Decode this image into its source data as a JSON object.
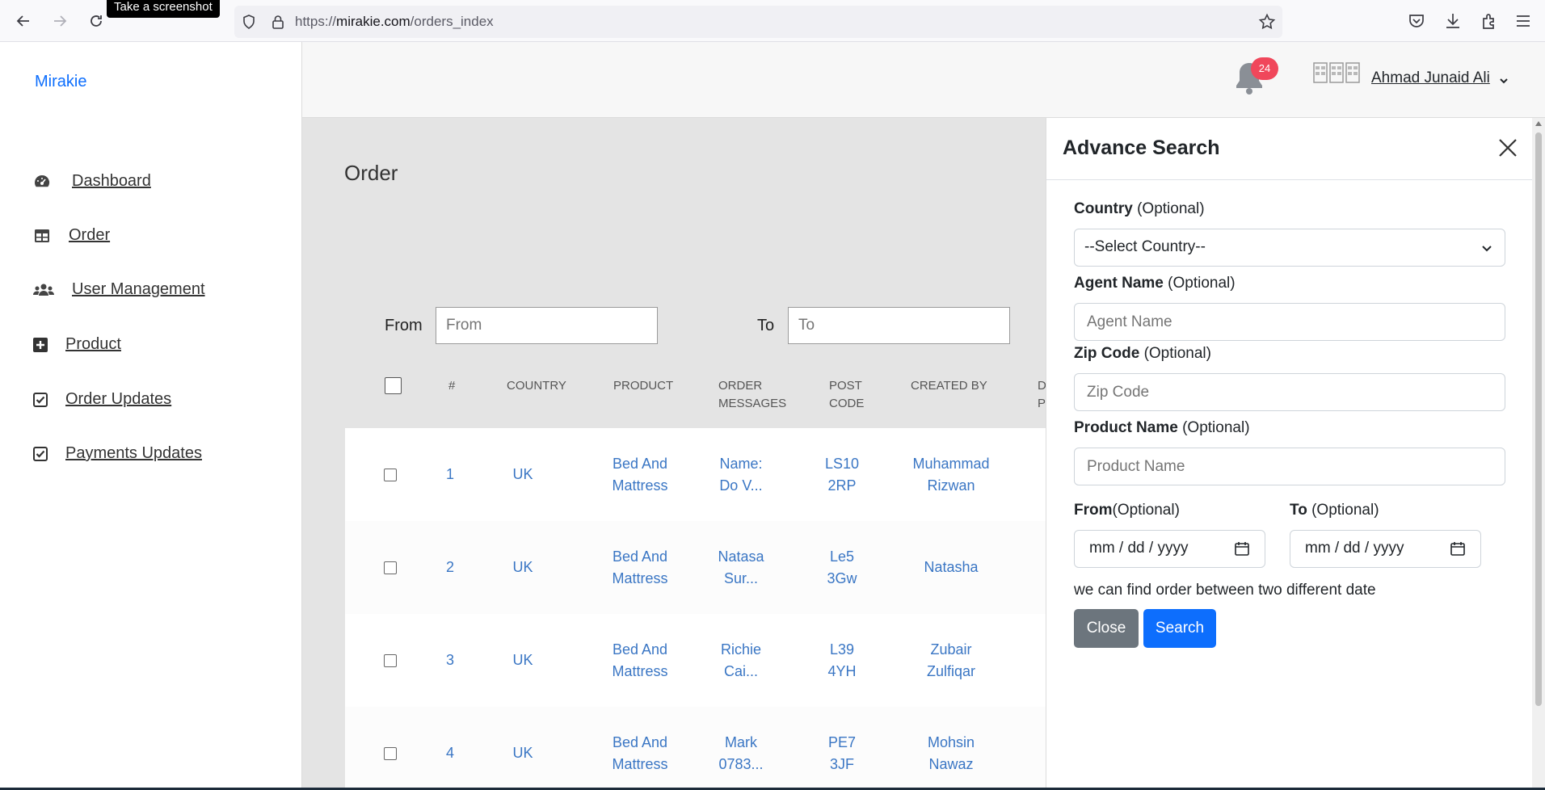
{
  "browser": {
    "tooltip": "Take a screenshot",
    "url_prefix": "https://",
    "url_domain": "mirakie.com",
    "url_path": "/orders_index"
  },
  "header": {
    "brand": "Mirakie",
    "notification_count": "24",
    "user_name": "Ahmad Junaid Ali"
  },
  "sidebar": {
    "items": [
      {
        "label": "Dashboard",
        "icon": "gauge-icon"
      },
      {
        "label": "Order",
        "icon": "table-icon"
      },
      {
        "label": "User Management",
        "icon": "users-icon"
      },
      {
        "label": "Product",
        "icon": "plus-square-icon"
      },
      {
        "label": "Order Updates",
        "icon": "check-square-icon"
      },
      {
        "label": "Payments Updates",
        "icon": "check-square-icon"
      }
    ]
  },
  "main": {
    "title": "Order",
    "filter": {
      "from_label": "From",
      "from_placeholder": "From",
      "to_label": "To",
      "to_placeholder": "To"
    },
    "columns": {
      "num": "#",
      "country": "COUNTRY",
      "product": "PRODUCT",
      "order_messages_1": "ORDER",
      "order_messages_2": "MESSAGES",
      "post_code_1": "POST",
      "post_code_2": "CODE",
      "created_by": "CREATED BY",
      "cut_1": "D",
      "cut_2": "P"
    },
    "rows": [
      {
        "num": "1",
        "country": "UK",
        "product_1": "Bed And",
        "product_2": "Mattress",
        "msg_1": "Name:",
        "msg_2": "Do V...",
        "post_1": "LS10",
        "post_2": "2RP",
        "created_1": "Muhammad",
        "created_2": "Rizwan"
      },
      {
        "num": "2",
        "country": "UK",
        "product_1": "Bed And",
        "product_2": "Mattress",
        "msg_1": "Natasa",
        "msg_2": "Sur...",
        "post_1": "Le5",
        "post_2": "3Gw",
        "created_1": "Natasha",
        "created_2": ""
      },
      {
        "num": "3",
        "country": "UK",
        "product_1": "Bed And",
        "product_2": "Mattress",
        "msg_1": "Richie",
        "msg_2": "Cai...",
        "post_1": "L39",
        "post_2": "4YH",
        "created_1": "Zubair",
        "created_2": "Zulfiqar"
      },
      {
        "num": "4",
        "country": "UK",
        "product_1": "Bed And",
        "product_2": "Mattress",
        "msg_1": "Mark",
        "msg_2": "0783...",
        "post_1": "PE7",
        "post_2": "3JF",
        "created_1": "Mohsin",
        "created_2": "Nawaz"
      }
    ]
  },
  "panel": {
    "title": "Advance Search",
    "country_label": "Country",
    "country_opt": "(Optional)",
    "country_value": "--Select Country--",
    "agent_label": "Agent Name",
    "agent_opt": "(Optional)",
    "agent_placeholder": "Agent Name",
    "zip_label": "Zip Code",
    "zip_opt": "(Optional)",
    "zip_placeholder": "Zip Code",
    "product_label": "Product Name",
    "product_opt": "(Optional)",
    "product_placeholder": "Product Name",
    "from_label": "From",
    "from_opt": "(Optional)",
    "to_label": "To",
    "to_opt": "(Optional)",
    "date_placeholder": "mm / dd / yyyy",
    "note": "we can find order between two different date",
    "close_button": "Close",
    "search_button": "Search"
  }
}
